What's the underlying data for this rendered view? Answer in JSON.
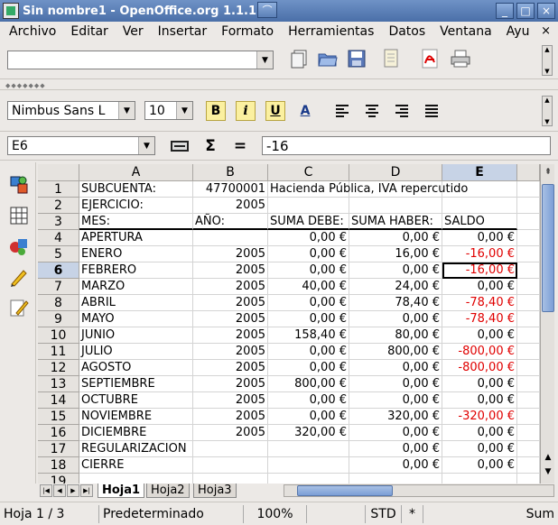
{
  "window": {
    "title": "Sin nombre1 - OpenOffice.org 1.1.1",
    "minimize": "_",
    "maximize": "□",
    "close": "×"
  },
  "menu": {
    "items": [
      "Archivo",
      "Editar",
      "Ver",
      "Insertar",
      "Formato",
      "Herramientas",
      "Datos",
      "Ventana",
      "Ayu"
    ],
    "close_doc": "×"
  },
  "toolbar": {
    "url_value": "",
    "font_name": "Nimbus Sans L",
    "font_size": "10",
    "bold": "B",
    "italic": "i",
    "underline": "U",
    "font_color": "A"
  },
  "formula_bar": {
    "cell_ref": "E6",
    "sum_icon": "Σ",
    "equals_icon": "=",
    "content": "-16"
  },
  "sheet": {
    "columns": [
      "A",
      "B",
      "C",
      "D",
      "E"
    ],
    "active_column": "E",
    "active_row": "6",
    "rows": [
      {
        "n": "1",
        "a": "SUBCUENTA:",
        "b": "47700001",
        "c": "Hacienda Pública, IVA repercutido",
        "d": "",
        "e": ""
      },
      {
        "n": "2",
        "a": "EJERCICIO:",
        "b": "2005",
        "c": "",
        "d": "",
        "e": ""
      },
      {
        "n": "3",
        "a": "MES:",
        "b": "AÑO:",
        "c": "SUMA DEBE:",
        "d": "SUMA HABER:",
        "e": "SALDO"
      },
      {
        "n": "4",
        "a": "APERTURA",
        "b": "",
        "c": "0,00 €",
        "d": "0,00 €",
        "e": "0,00 €"
      },
      {
        "n": "5",
        "a": "ENERO",
        "b": "2005",
        "c": "0,00 €",
        "d": "16,00 €",
        "e": "-16,00 €"
      },
      {
        "n": "6",
        "a": "FEBRERO",
        "b": "2005",
        "c": "0,00 €",
        "d": "0,00 €",
        "e": "-16,00 €"
      },
      {
        "n": "7",
        "a": "MARZO",
        "b": "2005",
        "c": "40,00 €",
        "d": "24,00 €",
        "e": "0,00 €"
      },
      {
        "n": "8",
        "a": "ABRIL",
        "b": "2005",
        "c": "0,00 €",
        "d": "78,40 €",
        "e": "-78,40 €"
      },
      {
        "n": "9",
        "a": "MAYO",
        "b": "2005",
        "c": "0,00 €",
        "d": "0,00 €",
        "e": "-78,40 €"
      },
      {
        "n": "10",
        "a": "JUNIO",
        "b": "2005",
        "c": "158,40 €",
        "d": "80,00 €",
        "e": "0,00 €"
      },
      {
        "n": "11",
        "a": "JULIO",
        "b": "2005",
        "c": "0,00 €",
        "d": "800,00 €",
        "e": "-800,00 €"
      },
      {
        "n": "12",
        "a": "AGOSTO",
        "b": "2005",
        "c": "0,00 €",
        "d": "0,00 €",
        "e": "-800,00 €"
      },
      {
        "n": "13",
        "a": "SEPTIEMBRE",
        "b": "2005",
        "c": "800,00 €",
        "d": "0,00 €",
        "e": "0,00 €"
      },
      {
        "n": "14",
        "a": "OCTUBRE",
        "b": "2005",
        "c": "0,00 €",
        "d": "0,00 €",
        "e": "0,00 €"
      },
      {
        "n": "15",
        "a": "NOVIEMBRE",
        "b": "2005",
        "c": "0,00 €",
        "d": "320,00 €",
        "e": "-320,00 €"
      },
      {
        "n": "16",
        "a": "DICIEMBRE",
        "b": "2005",
        "c": "320,00 €",
        "d": "0,00 €",
        "e": "0,00 €"
      },
      {
        "n": "17",
        "a": "REGULARIZACION",
        "b": "",
        "c": "",
        "d": "0,00 €",
        "e": "0,00 €"
      },
      {
        "n": "18",
        "a": "CIERRE",
        "b": "",
        "c": "",
        "d": "0,00 €",
        "e": "0,00 €"
      },
      {
        "n": "19",
        "a": "",
        "b": "",
        "c": "",
        "d": "",
        "e": ""
      }
    ],
    "tabs": [
      "Hoja1",
      "Hoja2",
      "Hoja3"
    ],
    "active_tab": "Hoja1"
  },
  "status": {
    "page": "Hoja 1 / 3",
    "style": "Predeterminado",
    "zoom": "100%",
    "mode": "STD",
    "modified": "*",
    "sum": "Sum"
  },
  "colors": {
    "negative": "#e00000",
    "title_bar": "#4a6fa8",
    "selection_header": "#c7d3e6"
  }
}
